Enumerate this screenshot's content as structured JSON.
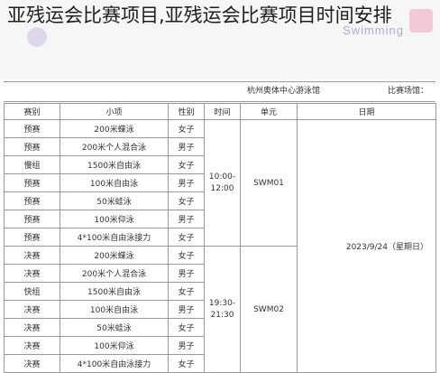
{
  "headline": "亚残运会比赛项目,亚残运会比赛项目时间安排",
  "banner_text": "Swimming",
  "venue": {
    "label": "比赛场馆：",
    "value": "杭州奥体中心游泳馆"
  },
  "columns": {
    "stage": "赛别",
    "event": "小项",
    "gender": "性别",
    "time": "时间",
    "unit": "单元",
    "date": "日期"
  },
  "date": "2023/9/24（星期日）",
  "units": [
    {
      "unit": "SWM01",
      "time": "10:00-12:00",
      "rows": [
        {
          "stage": "预赛",
          "event": "200米蝶泳",
          "gender": "女子"
        },
        {
          "stage": "预赛",
          "event": "200米个人混合泳",
          "gender": "男子"
        },
        {
          "stage": "慢组",
          "event": "1500米自由泳",
          "gender": "女子"
        },
        {
          "stage": "预赛",
          "event": "100米自由泳",
          "gender": "男子"
        },
        {
          "stage": "预赛",
          "event": "50米蛙泳",
          "gender": "女子"
        },
        {
          "stage": "预赛",
          "event": "100米仰泳",
          "gender": "男子"
        },
        {
          "stage": "预赛",
          "event": "4*100米自由泳接力",
          "gender": "女子"
        }
      ]
    },
    {
      "unit": "SWM02",
      "time": "19:30-21:30",
      "rows": [
        {
          "stage": "决赛",
          "event": "200米蝶泳",
          "gender": "女子"
        },
        {
          "stage": "决赛",
          "event": "200米个人混合泳",
          "gender": "男子"
        },
        {
          "stage": "快组",
          "event": "1500米自由泳",
          "gender": "女子"
        },
        {
          "stage": "决赛",
          "event": "100米自由泳",
          "gender": "男子"
        },
        {
          "stage": "决赛",
          "event": "50米蛙泳",
          "gender": "女子"
        },
        {
          "stage": "决赛",
          "event": "100米仰泳",
          "gender": "男子"
        },
        {
          "stage": "决赛",
          "event": "4*100米自由泳接力",
          "gender": "女子"
        }
      ]
    }
  ]
}
